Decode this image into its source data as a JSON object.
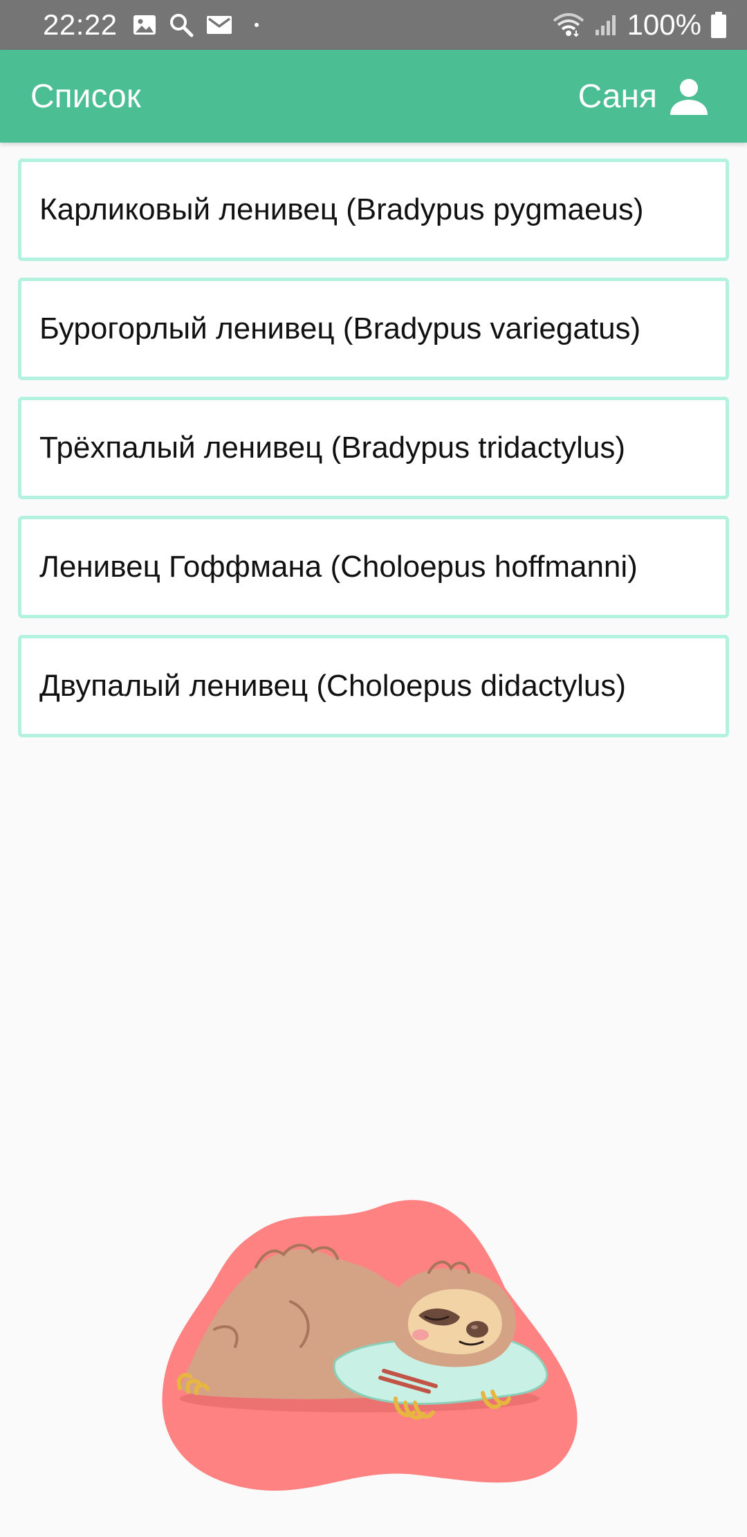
{
  "status_bar": {
    "time": "22:22",
    "battery": "100%",
    "icons": [
      "image-icon",
      "search-icon",
      "mail-icon",
      "wifi-icon",
      "signal-icon",
      "battery-icon"
    ]
  },
  "app_bar": {
    "title": "Список",
    "user_name": "Саня",
    "user_icon": "person-icon",
    "color": "#4cbe93"
  },
  "species_list": {
    "border_color": "#b2f2df",
    "items": [
      {
        "label": "Карликовый ленивец (Bradypus pygmaeus)"
      },
      {
        "label": "Бурогорлый ленивец (Bradypus variegatus)"
      },
      {
        "label": "Трёхпалый ленивец (Bradypus tridactylus)"
      },
      {
        "label": "Ленивец Гоффмана (Choloepus hoffmanni)"
      },
      {
        "label": "Двупалый ленивец (Choloepus didactylus)"
      }
    ]
  },
  "illustration": {
    "name": "sleeping-sloth",
    "background_color": "#ff8282"
  }
}
